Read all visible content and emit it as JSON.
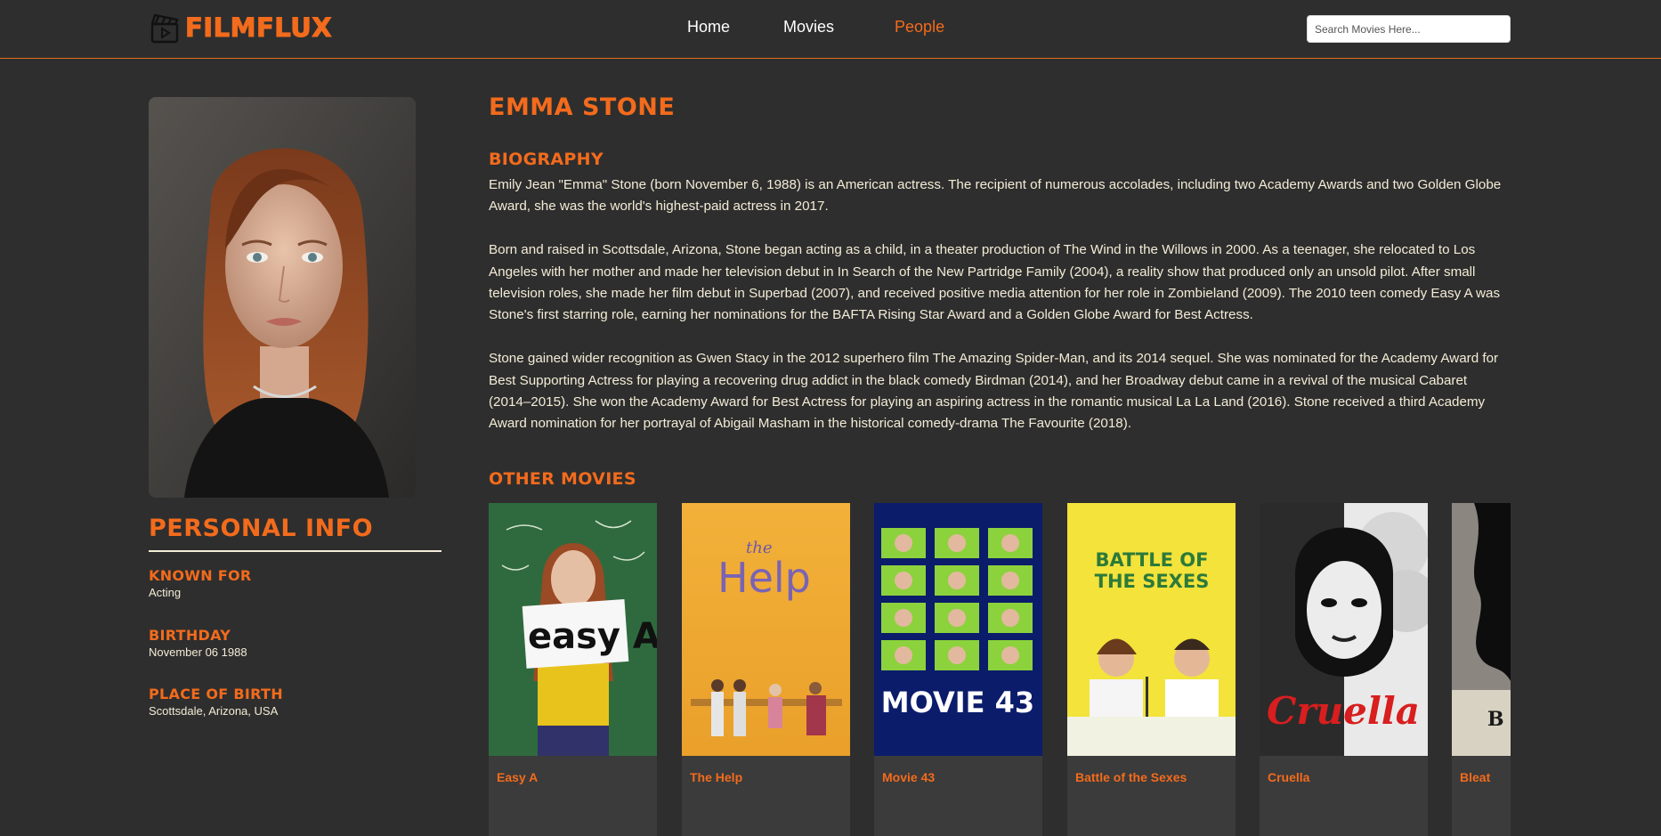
{
  "header": {
    "logo_text": "FILMFLUX",
    "logo_icon": "clapperboard-icon",
    "nav": [
      {
        "label": "Home",
        "active": false
      },
      {
        "label": "Movies",
        "active": false
      },
      {
        "label": "People",
        "active": true
      }
    ],
    "search_placeholder": "Search Movies Here..."
  },
  "person": {
    "name": "EMMA STONE",
    "personal_info_title": "PERSONAL INFO",
    "known_for_label": "KNOWN FOR",
    "known_for": "Acting",
    "birthday_label": "BIRTHDAY",
    "birthday": "November 06 1988",
    "birthplace_label": "PLACE OF BIRTH",
    "birthplace": "Scottsdale, Arizona, USA"
  },
  "biography": {
    "title": "BIOGRAPHY",
    "paragraphs": [
      "Emily Jean \"Emma\" Stone (born November 6, 1988) is an American actress. The recipient of numerous accolades, including two Academy Awards and two Golden Globe Award, she was the world's highest-paid actress in 2017.",
      "Born and raised in Scottsdale, Arizona, Stone began acting as a child, in a theater production of The Wind in the Willows in 2000. As a teenager, she relocated to Los Angeles with her mother and made her television debut in In Search of the New Partridge Family (2004), a reality show that produced only an unsold pilot. After small television roles, she made her film debut in Superbad (2007), and received positive media attention for her role in Zombieland (2009). The 2010 teen comedy Easy A was Stone's first starring role, earning her nominations for the BAFTA Rising Star Award and a Golden Globe Award for Best Actress.",
      "Stone gained wider recognition as Gwen Stacy in the 2012 superhero film The Amazing Spider-Man, and its 2014 sequel. She was nominated for the Academy Award for Best Supporting Actress for playing a recovering drug addict in the black comedy Birdman (2014), and her Broadway debut came in a revival of the musical Cabaret (2014–2015). She won the Academy Award for Best Actress for playing an aspiring actress in the romantic musical La La Land (2016). Stone received a third Academy Award nomination for her portrayal of Abigail Masham in the historical comedy-drama The Favourite (2018)."
    ]
  },
  "other_movies": {
    "title": "OTHER MOVIES",
    "items": [
      {
        "title": "Easy A",
        "poster_text": "easy A"
      },
      {
        "title": "The Help",
        "poster_text": "Help"
      },
      {
        "title": "Movie 43",
        "poster_text": "MOVIE 43"
      },
      {
        "title": "Battle of the Sexes",
        "poster_text": "BATTLE OF THE SEXES"
      },
      {
        "title": "Cruella",
        "poster_text": "Cruella"
      },
      {
        "title": "Bleat",
        "poster_text": "B"
      }
    ]
  },
  "colors": {
    "accent": "#f36b1c",
    "background": "#2e2e2e",
    "text": "#f3ecd6"
  }
}
